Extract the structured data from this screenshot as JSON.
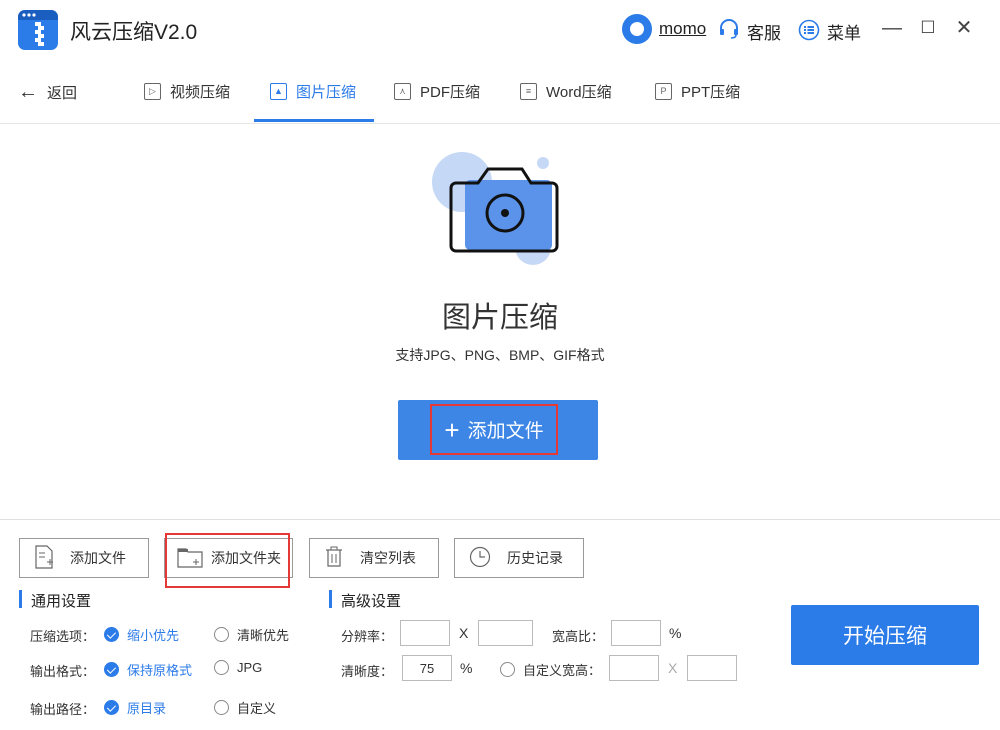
{
  "app": {
    "title": "风云压缩V2.0",
    "user": "momo",
    "service": "客服",
    "menu": "菜单"
  },
  "window": {
    "minimize": "—",
    "maximize": "☐",
    "close": "✕"
  },
  "nav": {
    "back": "返回",
    "tabs": [
      {
        "label": "视频压缩",
        "icon": "video-icon",
        "active": false
      },
      {
        "label": "图片压缩",
        "icon": "image-icon",
        "active": true
      },
      {
        "label": "PDF压缩",
        "icon": "pdf-icon",
        "active": false
      },
      {
        "label": "Word压缩",
        "icon": "word-icon",
        "active": false
      },
      {
        "label": "PPT压缩",
        "icon": "ppt-icon",
        "active": false
      }
    ]
  },
  "hero": {
    "title": "图片压缩",
    "subtitle": "支持JPG、PNG、BMP、GIF格式",
    "add_button": "添加文件"
  },
  "toolbar": {
    "add_file": "添加文件",
    "add_folder": "添加文件夹",
    "clear_list": "清空列表",
    "history": "历史记录"
  },
  "general": {
    "title": "通用设置",
    "compress_label": "压缩选项：",
    "compress_options": [
      "缩小优先",
      "清晰优先"
    ],
    "format_label": "输出格式：",
    "format_options": [
      "保持原格式",
      "JPG"
    ],
    "path_label": "输出路径：",
    "path_options": [
      "原目录",
      "自定义"
    ]
  },
  "advanced": {
    "title": "高级设置",
    "resolution_label": "分辨率：",
    "resolution_x": "X",
    "aspect_label": "宽高比：",
    "aspect_unit": "%",
    "clarity_label": "清晰度：",
    "clarity_value": "75",
    "clarity_unit": "%",
    "custom_label": "自定义宽高：",
    "custom_x": "X"
  },
  "start_button": "开始压缩",
  "colors": {
    "accent": "#2b7be8",
    "highlight": "#e53935"
  }
}
